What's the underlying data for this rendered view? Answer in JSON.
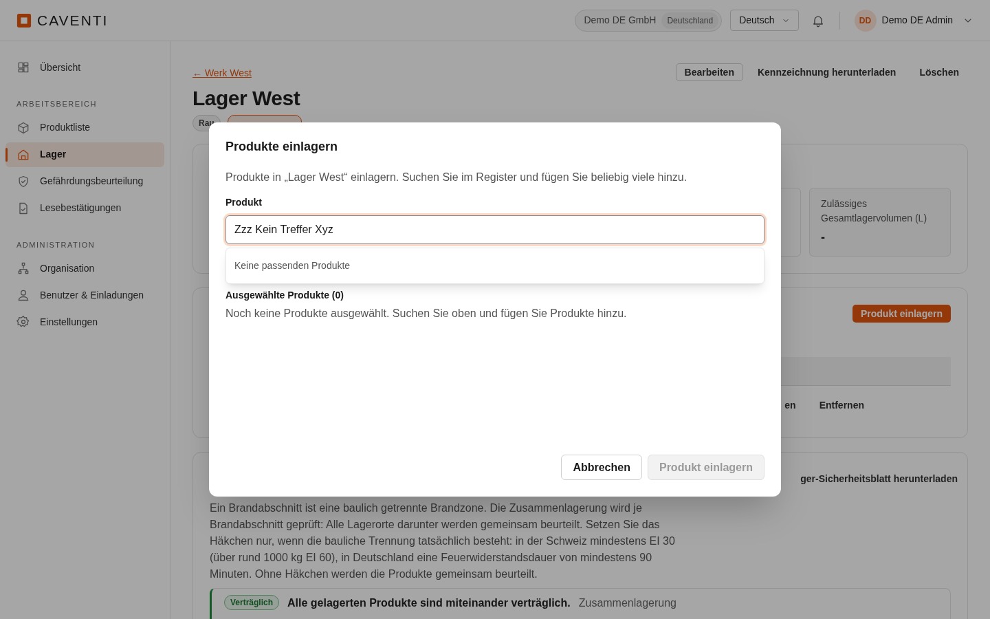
{
  "header": {
    "brand": "CAVENTI",
    "organization": "Demo DE GmbH",
    "country": "Deutschland",
    "language": "Deutsch",
    "user": {
      "initials": "DD",
      "name": "Demo DE Admin"
    }
  },
  "sidebar": {
    "sections": [
      {
        "items": [
          {
            "label": "Übersicht",
            "selected": false
          }
        ]
      },
      {
        "heading": "ARBEITSBEREICH",
        "items": [
          {
            "label": "Produktliste",
            "selected": false
          },
          {
            "label": "Lager",
            "selected": true
          },
          {
            "label": "Gefährdungsbeurteilung",
            "selected": false
          },
          {
            "label": "Lesebestätigungen",
            "selected": false
          }
        ]
      },
      {
        "heading": "ADMINISTRATION",
        "items": [
          {
            "label": "Organisation",
            "selected": false
          },
          {
            "label": "Benutzer & Einladungen",
            "selected": false
          },
          {
            "label": "Einstellungen",
            "selected": false
          }
        ]
      }
    ]
  },
  "page": {
    "back_link": "← Werk West",
    "title": "Lager West",
    "tags": [
      {
        "label": "Rau",
        "kind": "neutral"
      },
      {
        "kind": "accent"
      }
    ],
    "actions": [
      {
        "label": "Bearbeiten",
        "kind": "outlined"
      },
      {
        "label": "Kennzeichnung herunterladen",
        "kind": "plain"
      },
      {
        "label": "Löschen",
        "kind": "plain"
      }
    ]
  },
  "summary_card": {
    "stats": [
      {
        "label": "Zulässiges Gesamtlagervolumen (L)",
        "value": "-"
      }
    ]
  },
  "products_card": {
    "add_button": "Produkt einlagern",
    "row_actions": [
      "en",
      "Entfernen"
    ]
  },
  "fire_section_card": {
    "header_action": "ger-Sicherheitsblatt herunterladen",
    "description": "Ein Brandabschnitt ist eine baulich getrennte Brandzone. Die Zusammenlagerung wird je Brandabschnitt geprüft: Alle Lagerorte darunter werden gemeinsam beurteilt. Setzen Sie das Häkchen nur, wenn die bauliche Trennung tatsächlich besteht: in der Schweiz mindestens EI 30 (über rund 1000 kg EI 60), in Deutschland eine Feuerwiderstandsdauer von mindestens 90 Minuten. Ohne Häkchen werden die Produkte gemeinsam beurteilt.",
    "compatibility": {
      "badge": "Verträglich",
      "message": "Alle gelagerten Produkte sind miteinander verträglich.",
      "detail": "Zusammenlagerung"
    }
  },
  "dialog": {
    "title": "Produkte einlagern",
    "description": "Produkte in „Lager West“ einlagern. Suchen Sie im Register und fügen Sie beliebig viele hinzu.",
    "field": {
      "label": "Produkt",
      "value": "Zzz Kein Treffer Xyz"
    },
    "dropdown": {
      "empty_text": "Keine passenden Produkte"
    },
    "selected": {
      "heading": "Ausgewählte Produkte (0)",
      "empty_text": "Noch keine Produkte ausgewählt. Suchen Sie oben und fügen Sie Produkte hinzu."
    },
    "buttons": [
      {
        "label": "Abbrechen",
        "disabled": false
      },
      {
        "label": "Produkt einlagern",
        "disabled": true
      }
    ]
  }
}
